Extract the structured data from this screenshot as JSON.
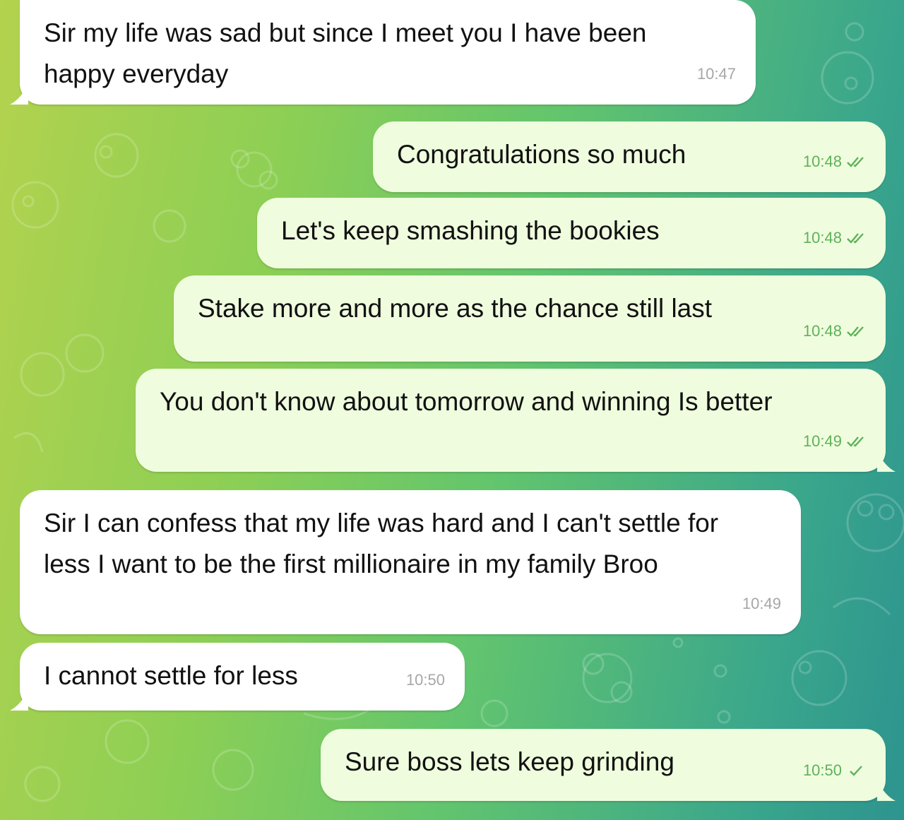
{
  "conversation": {
    "background_color": "#7cc95c",
    "messages": [
      {
        "text": "Sir my life was sad but since I meet you I have been happy everyday",
        "time": "10:47"
      },
      {
        "text": "Congratulations so much",
        "time": "10:48",
        "status_icon": "double-check-icon"
      },
      {
        "text": "Let's keep smashing the bookies",
        "time": "10:48",
        "status_icon": "double-check-icon"
      },
      {
        "text": "Stake more and more as the chance still last",
        "time": "10:48",
        "status_icon": "double-check-icon"
      },
      {
        "text": "You don't know about tomorrow and winning Is better",
        "time": "10:49",
        "status_icon": "double-check-icon"
      },
      {
        "text": "Sir I can confess that my life was hard and I can't settle for less I want to be the first millionaire in my family Broo",
        "time": "10:49"
      },
      {
        "text": "I cannot settle for less",
        "time": "10:50"
      },
      {
        "text": "Sure boss lets keep grinding",
        "time": "10:50",
        "status_icon": "single-check-icon"
      }
    ]
  }
}
